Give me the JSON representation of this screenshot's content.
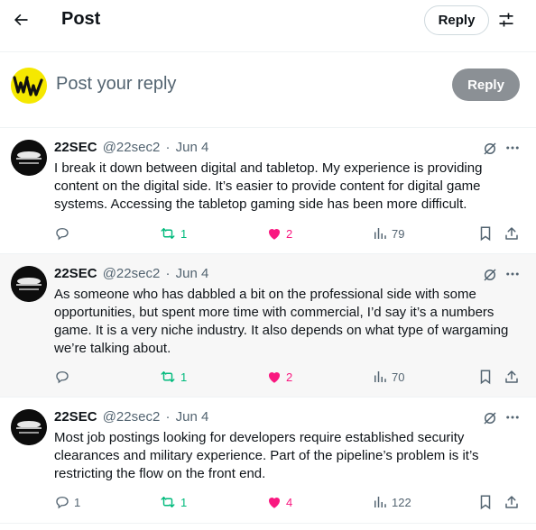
{
  "header": {
    "title": "Post",
    "reply_button": "Reply"
  },
  "composer": {
    "placeholder": "Post your reply",
    "reply_button": "Reply"
  },
  "tweets": [
    {
      "author": "22SEC",
      "handle": "@22sec2",
      "separator": "·",
      "date": "Jun 4",
      "text": "I break it down between digital and tabletop. My experience is providing content on the digital side. It’s easier to provide content for digital game systems. Accessing the tabletop gaming side has been more difficult.",
      "replies": "",
      "reposts": "1",
      "likes": "2",
      "views": "79"
    },
    {
      "author": "22SEC",
      "handle": "@22sec2",
      "separator": "·",
      "date": "Jun 4",
      "text": "As someone who has dabbled a bit on the professional side with some opportunities, but spent more time with commercial, I’d say it’s a numbers game. It is a very niche industry. It also depends on what type of wargaming we’re talking about.",
      "replies": "",
      "reposts": "1",
      "likes": "2",
      "views": "70"
    },
    {
      "author": "22SEC",
      "handle": "@22sec2",
      "separator": "·",
      "date": "Jun 4",
      "text": "Most job postings looking for developers require established security clearances and military experience. Part of the pipeline’s problem is it’s restricting the flow on the front end.",
      "replies": "1",
      "reposts": "1",
      "likes": "4",
      "views": "122"
    }
  ],
  "colors": {
    "repost": "#00ba7c",
    "like": "#f91880",
    "muted": "#536471",
    "avatar_ww_bg": "#f5e800",
    "reply_disabled": "#8b9095"
  }
}
